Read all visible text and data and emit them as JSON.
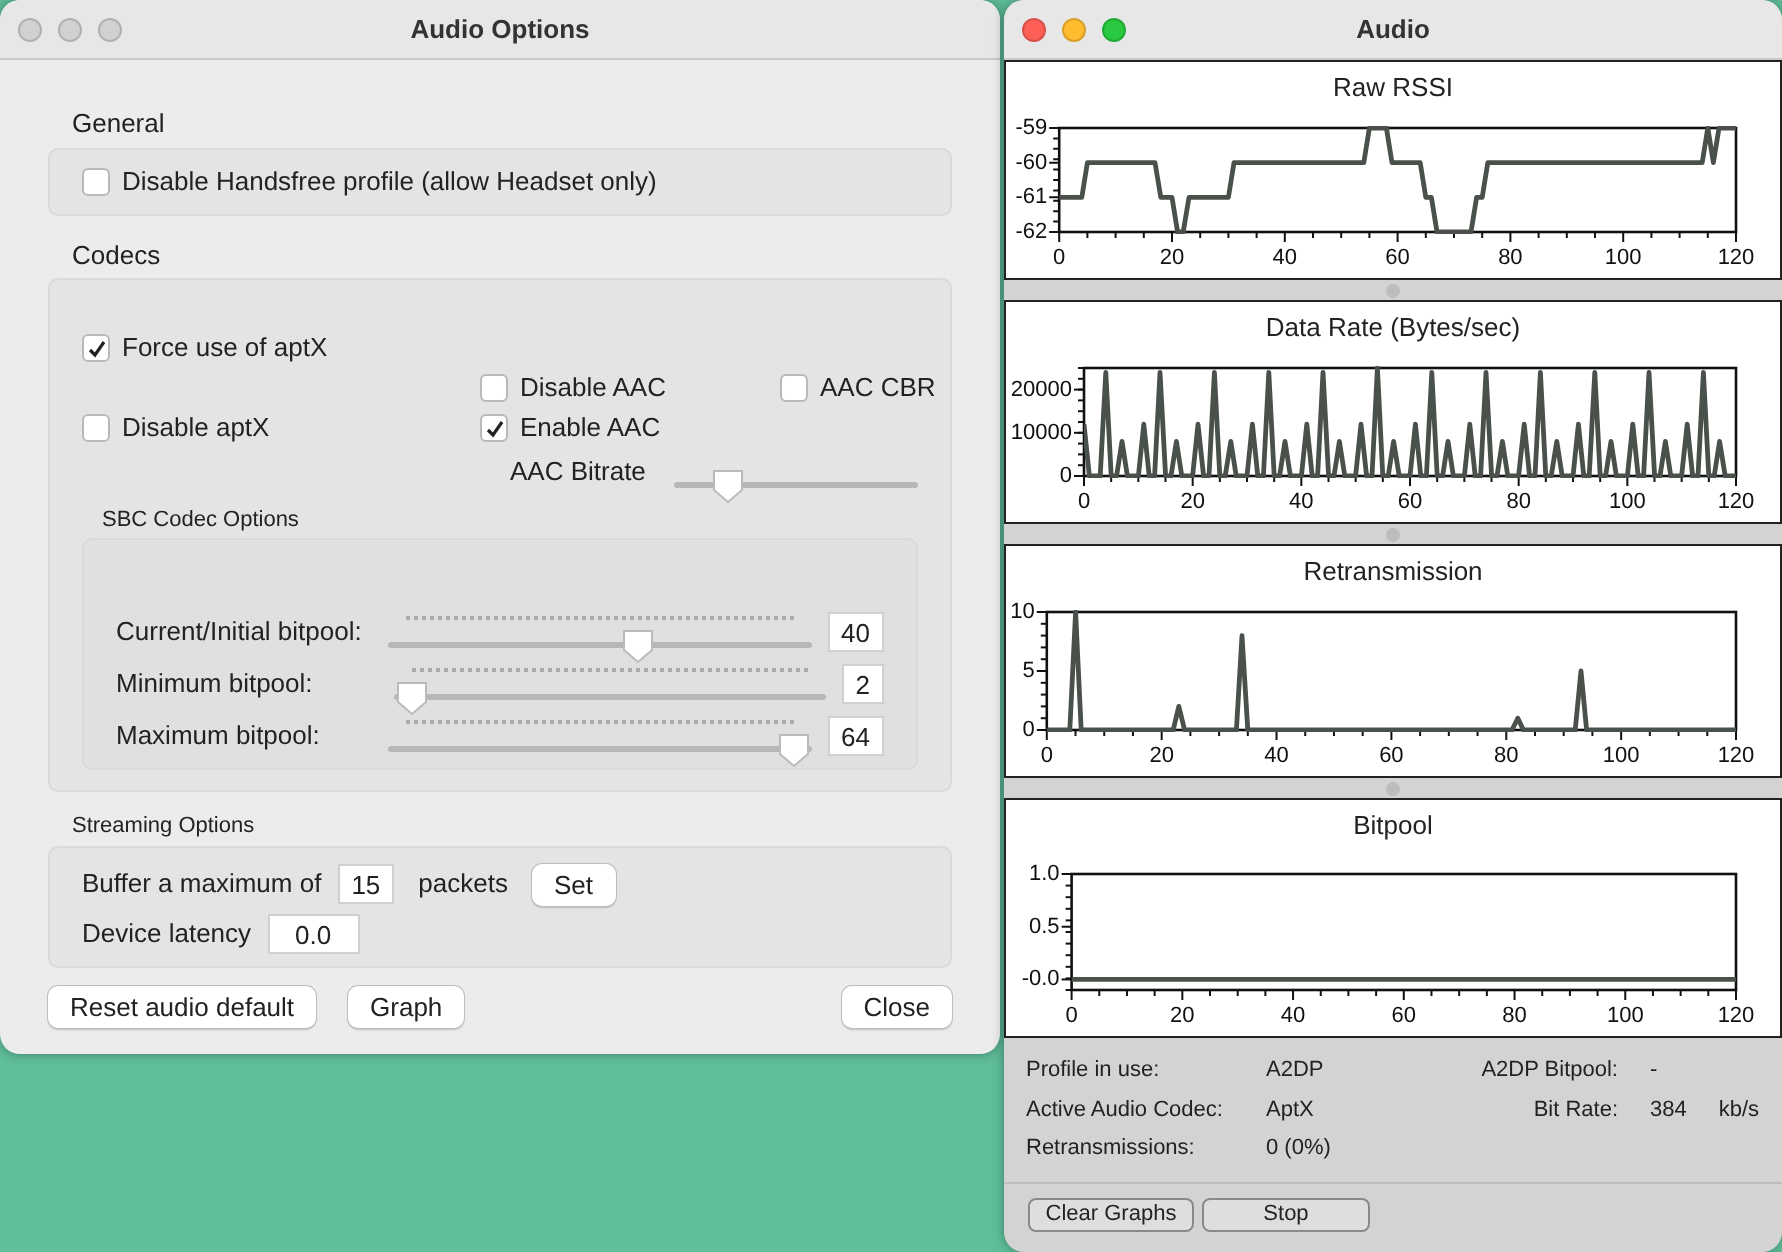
{
  "options_window": {
    "title": "Audio Options",
    "general": {
      "heading": "General",
      "disable_handsfree": {
        "label": "Disable Handsfree profile (allow Headset only)",
        "checked": false
      }
    },
    "codecs": {
      "heading": "Codecs",
      "force_aptx": {
        "label": "Force use of aptX",
        "checked": true
      },
      "disable_aac": {
        "label": "Disable AAC",
        "checked": false
      },
      "aac_cbr": {
        "label": "AAC CBR",
        "checked": false
      },
      "disable_aptx": {
        "label": "Disable aptX",
        "checked": false
      },
      "enable_aac": {
        "label": "Enable AAC",
        "checked": true
      },
      "aac_bitrate": {
        "label": "AAC Bitrate",
        "level": 0.17
      },
      "sbc": {
        "heading": "SBC Codec Options",
        "sliders": [
          {
            "label": "Current/Initial bitpool:",
            "level": 0.6,
            "value": "40"
          },
          {
            "label": "Minimum bitpool:",
            "level": 0.0,
            "value": "2"
          },
          {
            "label": "Maximum bitpool:",
            "level": 1.0,
            "value": "64"
          }
        ]
      }
    },
    "streaming": {
      "heading": "Streaming Options",
      "buffer_label": "Buffer a maximum of",
      "buffer_value": "15",
      "buffer_unit": "packets",
      "set_button": "Set",
      "latency_label": "Device latency",
      "latency_value": "0.0"
    },
    "buttons": [
      "Reset audio default",
      "Graph",
      "Close"
    ]
  },
  "graph_window": {
    "title": "Audio",
    "graphs": [
      {
        "chart_data": {
          "type": "line",
          "title": "Raw RSSI",
          "xlim": [
            0,
            120
          ],
          "ylim": [
            -62,
            -59
          ],
          "xticks": [
            0,
            20,
            40,
            60,
            80,
            100,
            120
          ],
          "yticks": [
            -62,
            -61,
            -60,
            -59
          ],
          "x": [
            0,
            4,
            5,
            17,
            18,
            20,
            21,
            22,
            23,
            30,
            31,
            54,
            55,
            58,
            59,
            64,
            65,
            66,
            67,
            73,
            74,
            75,
            76,
            114,
            115,
            116,
            117,
            120
          ],
          "series": [
            {
              "color": "#4a504a",
              "values": [
                -61,
                -61,
                -60,
                -60,
                -61,
                -61,
                -62,
                -62,
                -61,
                -61,
                -60,
                -60,
                -59,
                -59,
                -60,
                -60,
                -61,
                -61,
                -62,
                -62,
                -61,
                -61,
                -60,
                -60,
                -59,
                -60,
                -59,
                -59
              ]
            }
          ]
        }
      },
      {
        "chart_data": {
          "type": "line",
          "title": "Data Rate (Bytes/sec)",
          "xlim": [
            0,
            120
          ],
          "ylim": [
            0,
            25000
          ],
          "xticks": [
            0,
            20,
            40,
            60,
            80,
            100,
            120
          ],
          "yticks": [
            0,
            10000,
            20000
          ],
          "x": [
            0,
            1,
            2,
            3,
            4,
            5,
            6,
            7,
            8,
            9,
            10,
            11,
            12,
            13,
            14,
            15,
            16,
            17,
            18,
            19,
            20,
            21,
            22,
            23,
            24,
            25,
            26,
            27,
            28,
            29,
            30,
            31,
            32,
            33,
            34,
            35,
            36,
            37,
            38,
            39,
            40,
            41,
            42,
            43,
            44,
            45,
            46,
            47,
            48,
            49,
            50,
            51,
            52,
            53,
            54,
            55,
            56,
            57,
            58,
            59,
            60,
            61,
            62,
            63,
            64,
            65,
            66,
            67,
            68,
            69,
            70,
            71,
            72,
            73,
            74,
            75,
            76,
            77,
            78,
            79,
            80,
            81,
            82,
            83,
            84,
            85,
            86,
            87,
            88,
            89,
            90,
            91,
            92,
            93,
            94,
            95,
            96,
            97,
            98,
            99,
            100,
            101,
            102,
            103,
            104,
            105,
            106,
            107,
            108,
            109,
            110,
            111,
            112,
            113,
            114,
            115,
            116,
            117,
            118,
            119,
            120
          ],
          "series": [
            {
              "color": "#4a504a",
              "values": [
                12000,
                0,
                0,
                0,
                24000,
                0,
                0,
                8000,
                0,
                0,
                0,
                12000,
                0,
                0,
                24000,
                0,
                0,
                8000,
                0,
                0,
                0,
                12000,
                0,
                0,
                24000,
                0,
                0,
                8000,
                0,
                0,
                0,
                12000,
                0,
                0,
                24000,
                0,
                0,
                8000,
                0,
                0,
                0,
                12000,
                0,
                0,
                24000,
                0,
                0,
                8000,
                0,
                0,
                0,
                12000,
                0,
                0,
                25000,
                0,
                0,
                8000,
                0,
                0,
                0,
                12000,
                0,
                0,
                24000,
                0,
                0,
                8000,
                0,
                0,
                0,
                12000,
                0,
                0,
                24000,
                0,
                0,
                8000,
                0,
                0,
                0,
                12000,
                0,
                0,
                24000,
                0,
                0,
                8000,
                0,
                0,
                0,
                12000,
                0,
                0,
                24000,
                0,
                0,
                8000,
                0,
                0,
                0,
                12000,
                0,
                0,
                24000,
                0,
                0,
                8000,
                0,
                0,
                0,
                12000,
                0,
                0,
                24000,
                0,
                0,
                8000,
                0,
                0,
                0
              ]
            }
          ]
        }
      },
      {
        "chart_data": {
          "type": "line",
          "title": "Retransmission",
          "xlim": [
            0,
            120
          ],
          "ylim": [
            0,
            10
          ],
          "xticks": [
            0,
            20,
            40,
            60,
            80,
            100,
            120
          ],
          "yticks": [
            0,
            5,
            10
          ],
          "x": [
            0,
            4,
            5,
            6,
            22,
            23,
            24,
            33,
            34,
            35,
            81,
            82,
            83,
            92,
            93,
            94,
            120
          ],
          "series": [
            {
              "color": "#4a504a",
              "values": [
                0,
                0,
                10,
                0,
                0,
                2,
                0,
                0,
                8,
                0,
                0,
                1,
                0,
                0,
                5,
                0,
                0
              ]
            }
          ]
        }
      },
      {
        "chart_data": {
          "type": "line",
          "title": "Bitpool",
          "xlim": [
            0,
            120
          ],
          "ylim": [
            -0.1,
            1.0
          ],
          "xticks": [
            0,
            20,
            40,
            60,
            80,
            100,
            120
          ],
          "yticks": [
            {
              "value": 0,
              "label": "-0.0"
            },
            {
              "value": 0.5,
              "label": "0.5"
            },
            {
              "value": 1.0,
              "label": "1.0"
            }
          ],
          "x": [
            0,
            120
          ],
          "series": [
            {
              "color": "#4a504a",
              "values": [
                0,
                0
              ]
            }
          ]
        }
      }
    ],
    "stats_left": [
      {
        "label": "Profile in use:",
        "value": "A2DP"
      },
      {
        "label": "Active Audio Codec:",
        "value": "AptX"
      },
      {
        "label": "Retransmissions:",
        "value": "0 (0%)"
      }
    ],
    "stats_right": [
      {
        "label": "A2DP Bitpool:",
        "value": "-"
      },
      {
        "label": "Bit Rate:",
        "value": "384",
        "unit": "kb/s"
      }
    ],
    "buttons": [
      "Clear Graphs",
      "Stop"
    ]
  }
}
